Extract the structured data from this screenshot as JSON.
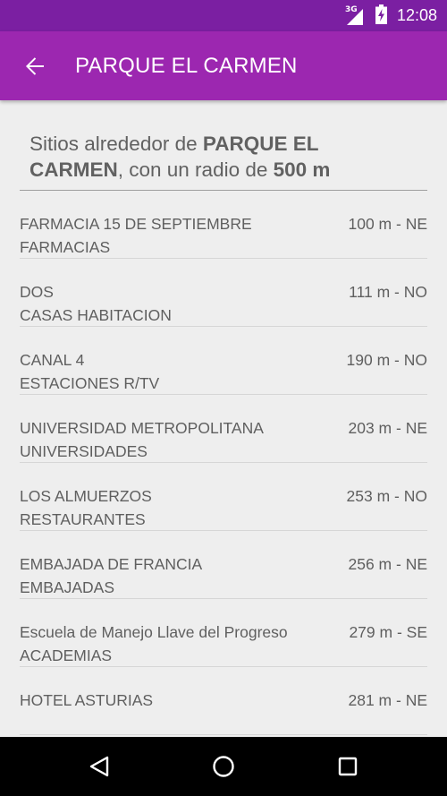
{
  "status_bar": {
    "network": "3G",
    "time": "12:08"
  },
  "app_bar": {
    "title": "PARQUE EL CARMEN"
  },
  "header": {
    "prefix": "Sitios alrededor de ",
    "place": "PARQUE EL CARMEN",
    "middle": ", con un radio de ",
    "radius": "500 m"
  },
  "places": [
    {
      "name": "FARMACIA 15 DE SEPTIEMBRE",
      "category": "FARMACIAS",
      "distance": "100 m - NE"
    },
    {
      "name": "DOS",
      "category": "CASAS HABITACION",
      "distance": "111 m - NO"
    },
    {
      "name": "CANAL 4",
      "category": "ESTACIONES R/TV",
      "distance": "190 m - NO"
    },
    {
      "name": "UNIVERSIDAD METROPOLITANA",
      "category": "UNIVERSIDADES",
      "distance": "203 m - NE"
    },
    {
      "name": "LOS ALMUERZOS",
      "category": "RESTAURANTES",
      "distance": "253 m - NO"
    },
    {
      "name": "EMBAJADA DE FRANCIA",
      "category": "EMBAJADAS",
      "distance": "256 m - NE"
    },
    {
      "name": "Escuela de Manejo Llave del Progreso",
      "category": "ACADEMIAS",
      "distance": "279 m - SE"
    },
    {
      "name": "HOTEL ASTURIAS",
      "category": "",
      "distance": "281 m - NE"
    }
  ],
  "icons": {
    "back": "arrow-left-icon",
    "signal": "cell-signal-icon",
    "battery": "battery-charging-icon",
    "nav_back": "triangle-back-icon",
    "nav_home": "circle-home-icon",
    "nav_recents": "square-recents-icon"
  },
  "colors": {
    "status_bar": "#7b1fa2",
    "app_bar": "#9c27b0",
    "background": "#eeeeee",
    "text": "#616161"
  }
}
